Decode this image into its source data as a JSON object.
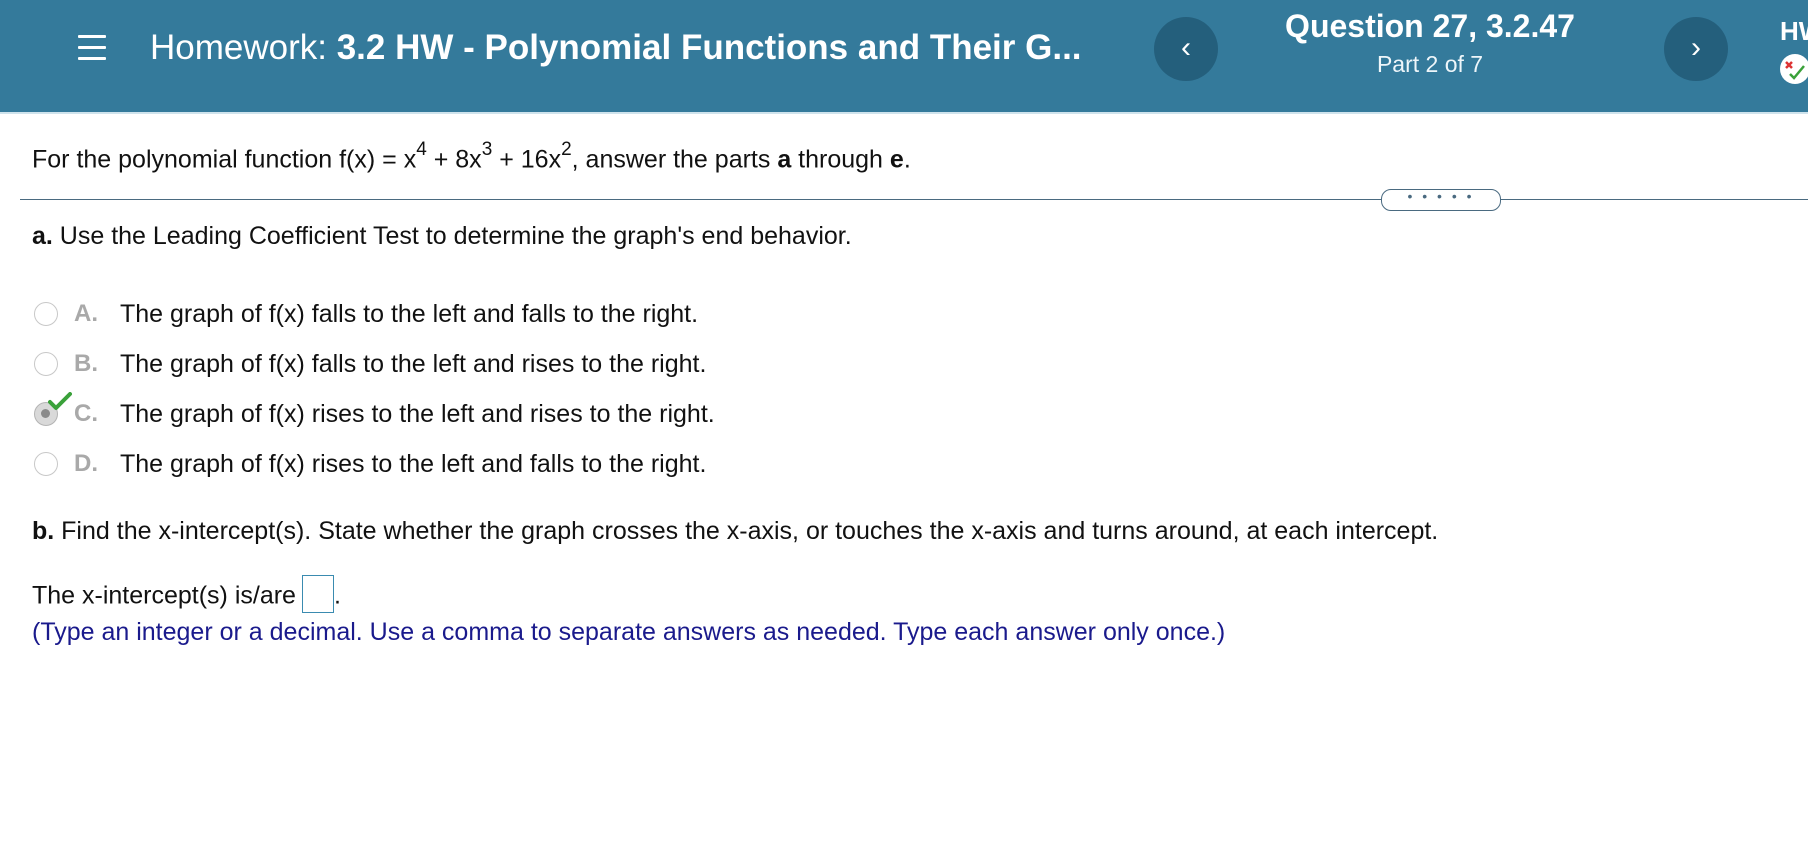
{
  "header": {
    "prefix": "Homework:",
    "assignment": "3.2 HW - Polynomial Functions and Their G...",
    "question_title": "Question 27, 3.2.47",
    "part": "Part 2 of 7",
    "right_label": "HW",
    "prev_glyph": "‹",
    "next_glyph": "›",
    "background_color": "#347a9b",
    "nav_button_color": "#245f7c"
  },
  "icons": {
    "menu": "hamburger-menu-icon",
    "prev": "chevron-left-icon",
    "next": "chevron-right-icon",
    "score": "score-check-x-icon",
    "correct": "green-checkmark-icon"
  },
  "prompt": {
    "lead": "For the polynomial function f(x) = x",
    "exp1": "4",
    "t2": " + 8x",
    "exp2": "3",
    "t3": " + 16x",
    "exp3": "2",
    "t4": ", answer the parts ",
    "bold_a": "a",
    "t5": " through ",
    "bold_e": "e",
    "t6": "."
  },
  "expand_dots": "• • • • •",
  "part_a": {
    "label": "a.",
    "text": " Use the Leading Coefficient Test to determine the graph's end behavior.",
    "options": [
      {
        "letter": "A.",
        "text": "The graph of f(x) falls to the left and falls to the right."
      },
      {
        "letter": "B.",
        "text": "The graph of f(x) falls to the left and rises to the right."
      },
      {
        "letter": "C.",
        "text": "The graph of f(x) rises to the left and rises to the right."
      },
      {
        "letter": "D.",
        "text": "The graph of f(x) rises to the left and falls to the right."
      }
    ],
    "selected": "C.",
    "correct_color": "#3aa13a"
  },
  "part_b": {
    "label": "b.",
    "text": " Find the x-intercept(s). State whether the graph crosses the x-axis, or touches the x-axis and turns around, at each intercept.",
    "answer_prefix": "The x-intercept(s) is/are",
    "answer_value": "",
    "answer_suffix": ".",
    "instructions": "(Type an integer or a decimal. Use a comma to separate answers as needed. Type each answer only once.)",
    "instructions_color": "#1a1a8c"
  }
}
